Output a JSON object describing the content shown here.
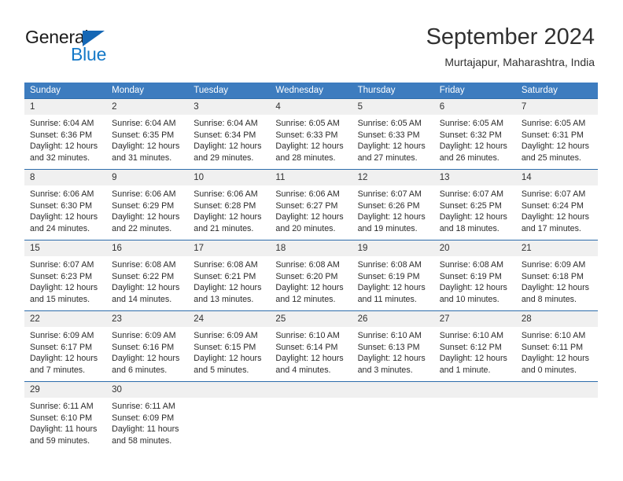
{
  "brand": {
    "name_part1": "General",
    "name_part2": "Blue",
    "accent_color": "#1579c8",
    "triangle_color": "#1567b5"
  },
  "header": {
    "title": "September 2024",
    "subtitle": "Murtajapur, Maharashtra, India"
  },
  "theme": {
    "header_row_bg": "#3d7cbf",
    "row_divider": "#2d6cab",
    "daynum_bg": "#f0f0f0",
    "text_color": "#2b2b2b"
  },
  "weekday_headers": [
    "Sunday",
    "Monday",
    "Tuesday",
    "Wednesday",
    "Thursday",
    "Friday",
    "Saturday"
  ],
  "weeks": [
    [
      {
        "day": "1",
        "sunrise": "Sunrise: 6:04 AM",
        "sunset": "Sunset: 6:36 PM",
        "daylight1": "Daylight: 12 hours",
        "daylight2": "and 32 minutes."
      },
      {
        "day": "2",
        "sunrise": "Sunrise: 6:04 AM",
        "sunset": "Sunset: 6:35 PM",
        "daylight1": "Daylight: 12 hours",
        "daylight2": "and 31 minutes."
      },
      {
        "day": "3",
        "sunrise": "Sunrise: 6:04 AM",
        "sunset": "Sunset: 6:34 PM",
        "daylight1": "Daylight: 12 hours",
        "daylight2": "and 29 minutes."
      },
      {
        "day": "4",
        "sunrise": "Sunrise: 6:05 AM",
        "sunset": "Sunset: 6:33 PM",
        "daylight1": "Daylight: 12 hours",
        "daylight2": "and 28 minutes."
      },
      {
        "day": "5",
        "sunrise": "Sunrise: 6:05 AM",
        "sunset": "Sunset: 6:33 PM",
        "daylight1": "Daylight: 12 hours",
        "daylight2": "and 27 minutes."
      },
      {
        "day": "6",
        "sunrise": "Sunrise: 6:05 AM",
        "sunset": "Sunset: 6:32 PM",
        "daylight1": "Daylight: 12 hours",
        "daylight2": "and 26 minutes."
      },
      {
        "day": "7",
        "sunrise": "Sunrise: 6:05 AM",
        "sunset": "Sunset: 6:31 PM",
        "daylight1": "Daylight: 12 hours",
        "daylight2": "and 25 minutes."
      }
    ],
    [
      {
        "day": "8",
        "sunrise": "Sunrise: 6:06 AM",
        "sunset": "Sunset: 6:30 PM",
        "daylight1": "Daylight: 12 hours",
        "daylight2": "and 24 minutes."
      },
      {
        "day": "9",
        "sunrise": "Sunrise: 6:06 AM",
        "sunset": "Sunset: 6:29 PM",
        "daylight1": "Daylight: 12 hours",
        "daylight2": "and 22 minutes."
      },
      {
        "day": "10",
        "sunrise": "Sunrise: 6:06 AM",
        "sunset": "Sunset: 6:28 PM",
        "daylight1": "Daylight: 12 hours",
        "daylight2": "and 21 minutes."
      },
      {
        "day": "11",
        "sunrise": "Sunrise: 6:06 AM",
        "sunset": "Sunset: 6:27 PM",
        "daylight1": "Daylight: 12 hours",
        "daylight2": "and 20 minutes."
      },
      {
        "day": "12",
        "sunrise": "Sunrise: 6:07 AM",
        "sunset": "Sunset: 6:26 PM",
        "daylight1": "Daylight: 12 hours",
        "daylight2": "and 19 minutes."
      },
      {
        "day": "13",
        "sunrise": "Sunrise: 6:07 AM",
        "sunset": "Sunset: 6:25 PM",
        "daylight1": "Daylight: 12 hours",
        "daylight2": "and 18 minutes."
      },
      {
        "day": "14",
        "sunrise": "Sunrise: 6:07 AM",
        "sunset": "Sunset: 6:24 PM",
        "daylight1": "Daylight: 12 hours",
        "daylight2": "and 17 minutes."
      }
    ],
    [
      {
        "day": "15",
        "sunrise": "Sunrise: 6:07 AM",
        "sunset": "Sunset: 6:23 PM",
        "daylight1": "Daylight: 12 hours",
        "daylight2": "and 15 minutes."
      },
      {
        "day": "16",
        "sunrise": "Sunrise: 6:08 AM",
        "sunset": "Sunset: 6:22 PM",
        "daylight1": "Daylight: 12 hours",
        "daylight2": "and 14 minutes."
      },
      {
        "day": "17",
        "sunrise": "Sunrise: 6:08 AM",
        "sunset": "Sunset: 6:21 PM",
        "daylight1": "Daylight: 12 hours",
        "daylight2": "and 13 minutes."
      },
      {
        "day": "18",
        "sunrise": "Sunrise: 6:08 AM",
        "sunset": "Sunset: 6:20 PM",
        "daylight1": "Daylight: 12 hours",
        "daylight2": "and 12 minutes."
      },
      {
        "day": "19",
        "sunrise": "Sunrise: 6:08 AM",
        "sunset": "Sunset: 6:19 PM",
        "daylight1": "Daylight: 12 hours",
        "daylight2": "and 11 minutes."
      },
      {
        "day": "20",
        "sunrise": "Sunrise: 6:08 AM",
        "sunset": "Sunset: 6:19 PM",
        "daylight1": "Daylight: 12 hours",
        "daylight2": "and 10 minutes."
      },
      {
        "day": "21",
        "sunrise": "Sunrise: 6:09 AM",
        "sunset": "Sunset: 6:18 PM",
        "daylight1": "Daylight: 12 hours",
        "daylight2": "and 8 minutes."
      }
    ],
    [
      {
        "day": "22",
        "sunrise": "Sunrise: 6:09 AM",
        "sunset": "Sunset: 6:17 PM",
        "daylight1": "Daylight: 12 hours",
        "daylight2": "and 7 minutes."
      },
      {
        "day": "23",
        "sunrise": "Sunrise: 6:09 AM",
        "sunset": "Sunset: 6:16 PM",
        "daylight1": "Daylight: 12 hours",
        "daylight2": "and 6 minutes."
      },
      {
        "day": "24",
        "sunrise": "Sunrise: 6:09 AM",
        "sunset": "Sunset: 6:15 PM",
        "daylight1": "Daylight: 12 hours",
        "daylight2": "and 5 minutes."
      },
      {
        "day": "25",
        "sunrise": "Sunrise: 6:10 AM",
        "sunset": "Sunset: 6:14 PM",
        "daylight1": "Daylight: 12 hours",
        "daylight2": "and 4 minutes."
      },
      {
        "day": "26",
        "sunrise": "Sunrise: 6:10 AM",
        "sunset": "Sunset: 6:13 PM",
        "daylight1": "Daylight: 12 hours",
        "daylight2": "and 3 minutes."
      },
      {
        "day": "27",
        "sunrise": "Sunrise: 6:10 AM",
        "sunset": "Sunset: 6:12 PM",
        "daylight1": "Daylight: 12 hours",
        "daylight2": "and 1 minute."
      },
      {
        "day": "28",
        "sunrise": "Sunrise: 6:10 AM",
        "sunset": "Sunset: 6:11 PM",
        "daylight1": "Daylight: 12 hours",
        "daylight2": "and 0 minutes."
      }
    ],
    [
      {
        "day": "29",
        "sunrise": "Sunrise: 6:11 AM",
        "sunset": "Sunset: 6:10 PM",
        "daylight1": "Daylight: 11 hours",
        "daylight2": "and 59 minutes."
      },
      {
        "day": "30",
        "sunrise": "Sunrise: 6:11 AM",
        "sunset": "Sunset: 6:09 PM",
        "daylight1": "Daylight: 11 hours",
        "daylight2": "and 58 minutes."
      },
      {
        "day": "",
        "sunrise": "",
        "sunset": "",
        "daylight1": "",
        "daylight2": ""
      },
      {
        "day": "",
        "sunrise": "",
        "sunset": "",
        "daylight1": "",
        "daylight2": ""
      },
      {
        "day": "",
        "sunrise": "",
        "sunset": "",
        "daylight1": "",
        "daylight2": ""
      },
      {
        "day": "",
        "sunrise": "",
        "sunset": "",
        "daylight1": "",
        "daylight2": ""
      },
      {
        "day": "",
        "sunrise": "",
        "sunset": "",
        "daylight1": "",
        "daylight2": ""
      }
    ]
  ]
}
